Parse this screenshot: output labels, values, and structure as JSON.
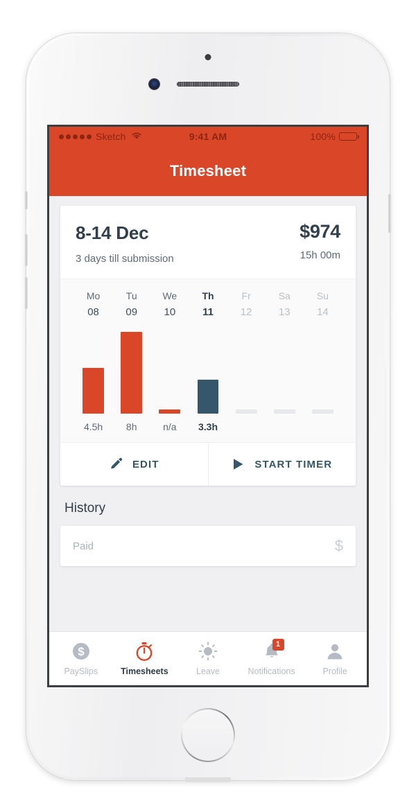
{
  "status_bar": {
    "carrier": "Sketch",
    "signal_dots": 5,
    "wifi_icon": "wifi-icon",
    "time": "9:41 AM",
    "battery_percent": "100%",
    "battery_icon": "battery-full-icon"
  },
  "nav": {
    "title": "Timesheet",
    "background_color": "#d94628"
  },
  "timesheet_card": {
    "period_range": "8-14 Dec",
    "submission_note": "3 days till submission",
    "total_amount": "$974",
    "total_hours": "15h 00m"
  },
  "chart_data": {
    "type": "bar",
    "title": "",
    "xlabel": "",
    "ylabel": "",
    "grid": false,
    "ylim": [
      0,
      8
    ],
    "categories": [
      "Mo 08",
      "Tu 09",
      "We 10",
      "Th 11",
      "Fr 12",
      "Sa 13",
      "Su 14"
    ],
    "day_names": [
      "Mo",
      "Tu",
      "We",
      "Th",
      "Fr",
      "Sa",
      "Su"
    ],
    "day_numbers": [
      "08",
      "09",
      "10",
      "11",
      "12",
      "13",
      "14"
    ],
    "values": [
      4.5,
      8,
      0.15,
      3.3,
      0,
      0,
      0
    ],
    "value_labels": [
      "4.5h",
      "8h",
      "n/a",
      "3.3h",
      "",
      "",
      ""
    ],
    "bar_colors": [
      "#d94628",
      "#d94628",
      "#d94628",
      "#36566b",
      "#e7e8ec",
      "#e7e8ec",
      "#e7e8ec"
    ],
    "today_index": 3,
    "future_indices": [
      4,
      5,
      6
    ],
    "legend": []
  },
  "card_actions": {
    "edit_label": "EDIT",
    "edit_icon": "pencil-icon",
    "start_timer_label": "START TIMER",
    "start_timer_icon": "play-icon"
  },
  "history": {
    "title": "History",
    "rows": [
      {
        "status": "Paid",
        "amount_icon": "dollar-sign-icon"
      }
    ]
  },
  "tab_bar": {
    "items": [
      {
        "label": "PaySlips",
        "icon": "dollar-circle-icon",
        "active": false
      },
      {
        "label": "Timesheets",
        "icon": "stopwatch-icon",
        "active": true
      },
      {
        "label": "Leave",
        "icon": "sun-icon",
        "active": false
      },
      {
        "label": "Notifications",
        "icon": "bell-icon",
        "active": false,
        "badge": "1"
      },
      {
        "label": "Profile",
        "icon": "person-icon",
        "active": false
      }
    ]
  },
  "colors": {
    "brand_orange": "#d94628",
    "accent_navy": "#36566b",
    "muted_gray": "#b4bbc3"
  }
}
